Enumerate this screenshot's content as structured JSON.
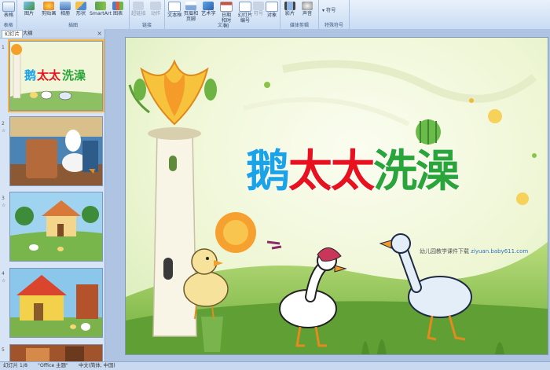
{
  "ribbon": {
    "groups": [
      {
        "label": "表格",
        "buttons": [
          "表格"
        ]
      },
      {
        "label": "插图",
        "buttons": [
          "图片",
          "剪贴画",
          "相册",
          "形状",
          "SmartArt",
          "图表"
        ]
      },
      {
        "label": "链接",
        "buttons": [
          "超链接",
          "动作"
        ]
      },
      {
        "label": "文本",
        "buttons": [
          "文本框",
          "页眉和页脚",
          "艺术字",
          "日期和时间",
          "幻灯片编号",
          "符号",
          "对象"
        ]
      },
      {
        "label": "媒体剪辑",
        "buttons": [
          "影片",
          "声音"
        ]
      },
      {
        "label": "特殊符号",
        "buttons": [
          "符号"
        ]
      }
    ]
  },
  "panel": {
    "tabs": [
      "幻灯片",
      "大纲"
    ],
    "close": "×",
    "slide_numbers": [
      "1",
      "2",
      "3",
      "4",
      "5"
    ]
  },
  "slide": {
    "title_chars": [
      "鹅",
      "太",
      "太",
      "洗",
      "澡"
    ],
    "title_colors": [
      "#1aa3e6",
      "#e8121e",
      "#e8121e",
      "#2aa53a",
      "#2aa53a"
    ],
    "watermark_text": "幼儿园教学课件下载",
    "watermark_url": "ziyuan.baby611.com"
  },
  "status": {
    "slide_count": "幻灯片 1/8",
    "theme": "\"Office 主题\"",
    "language": "中文(简体, 中国)"
  }
}
